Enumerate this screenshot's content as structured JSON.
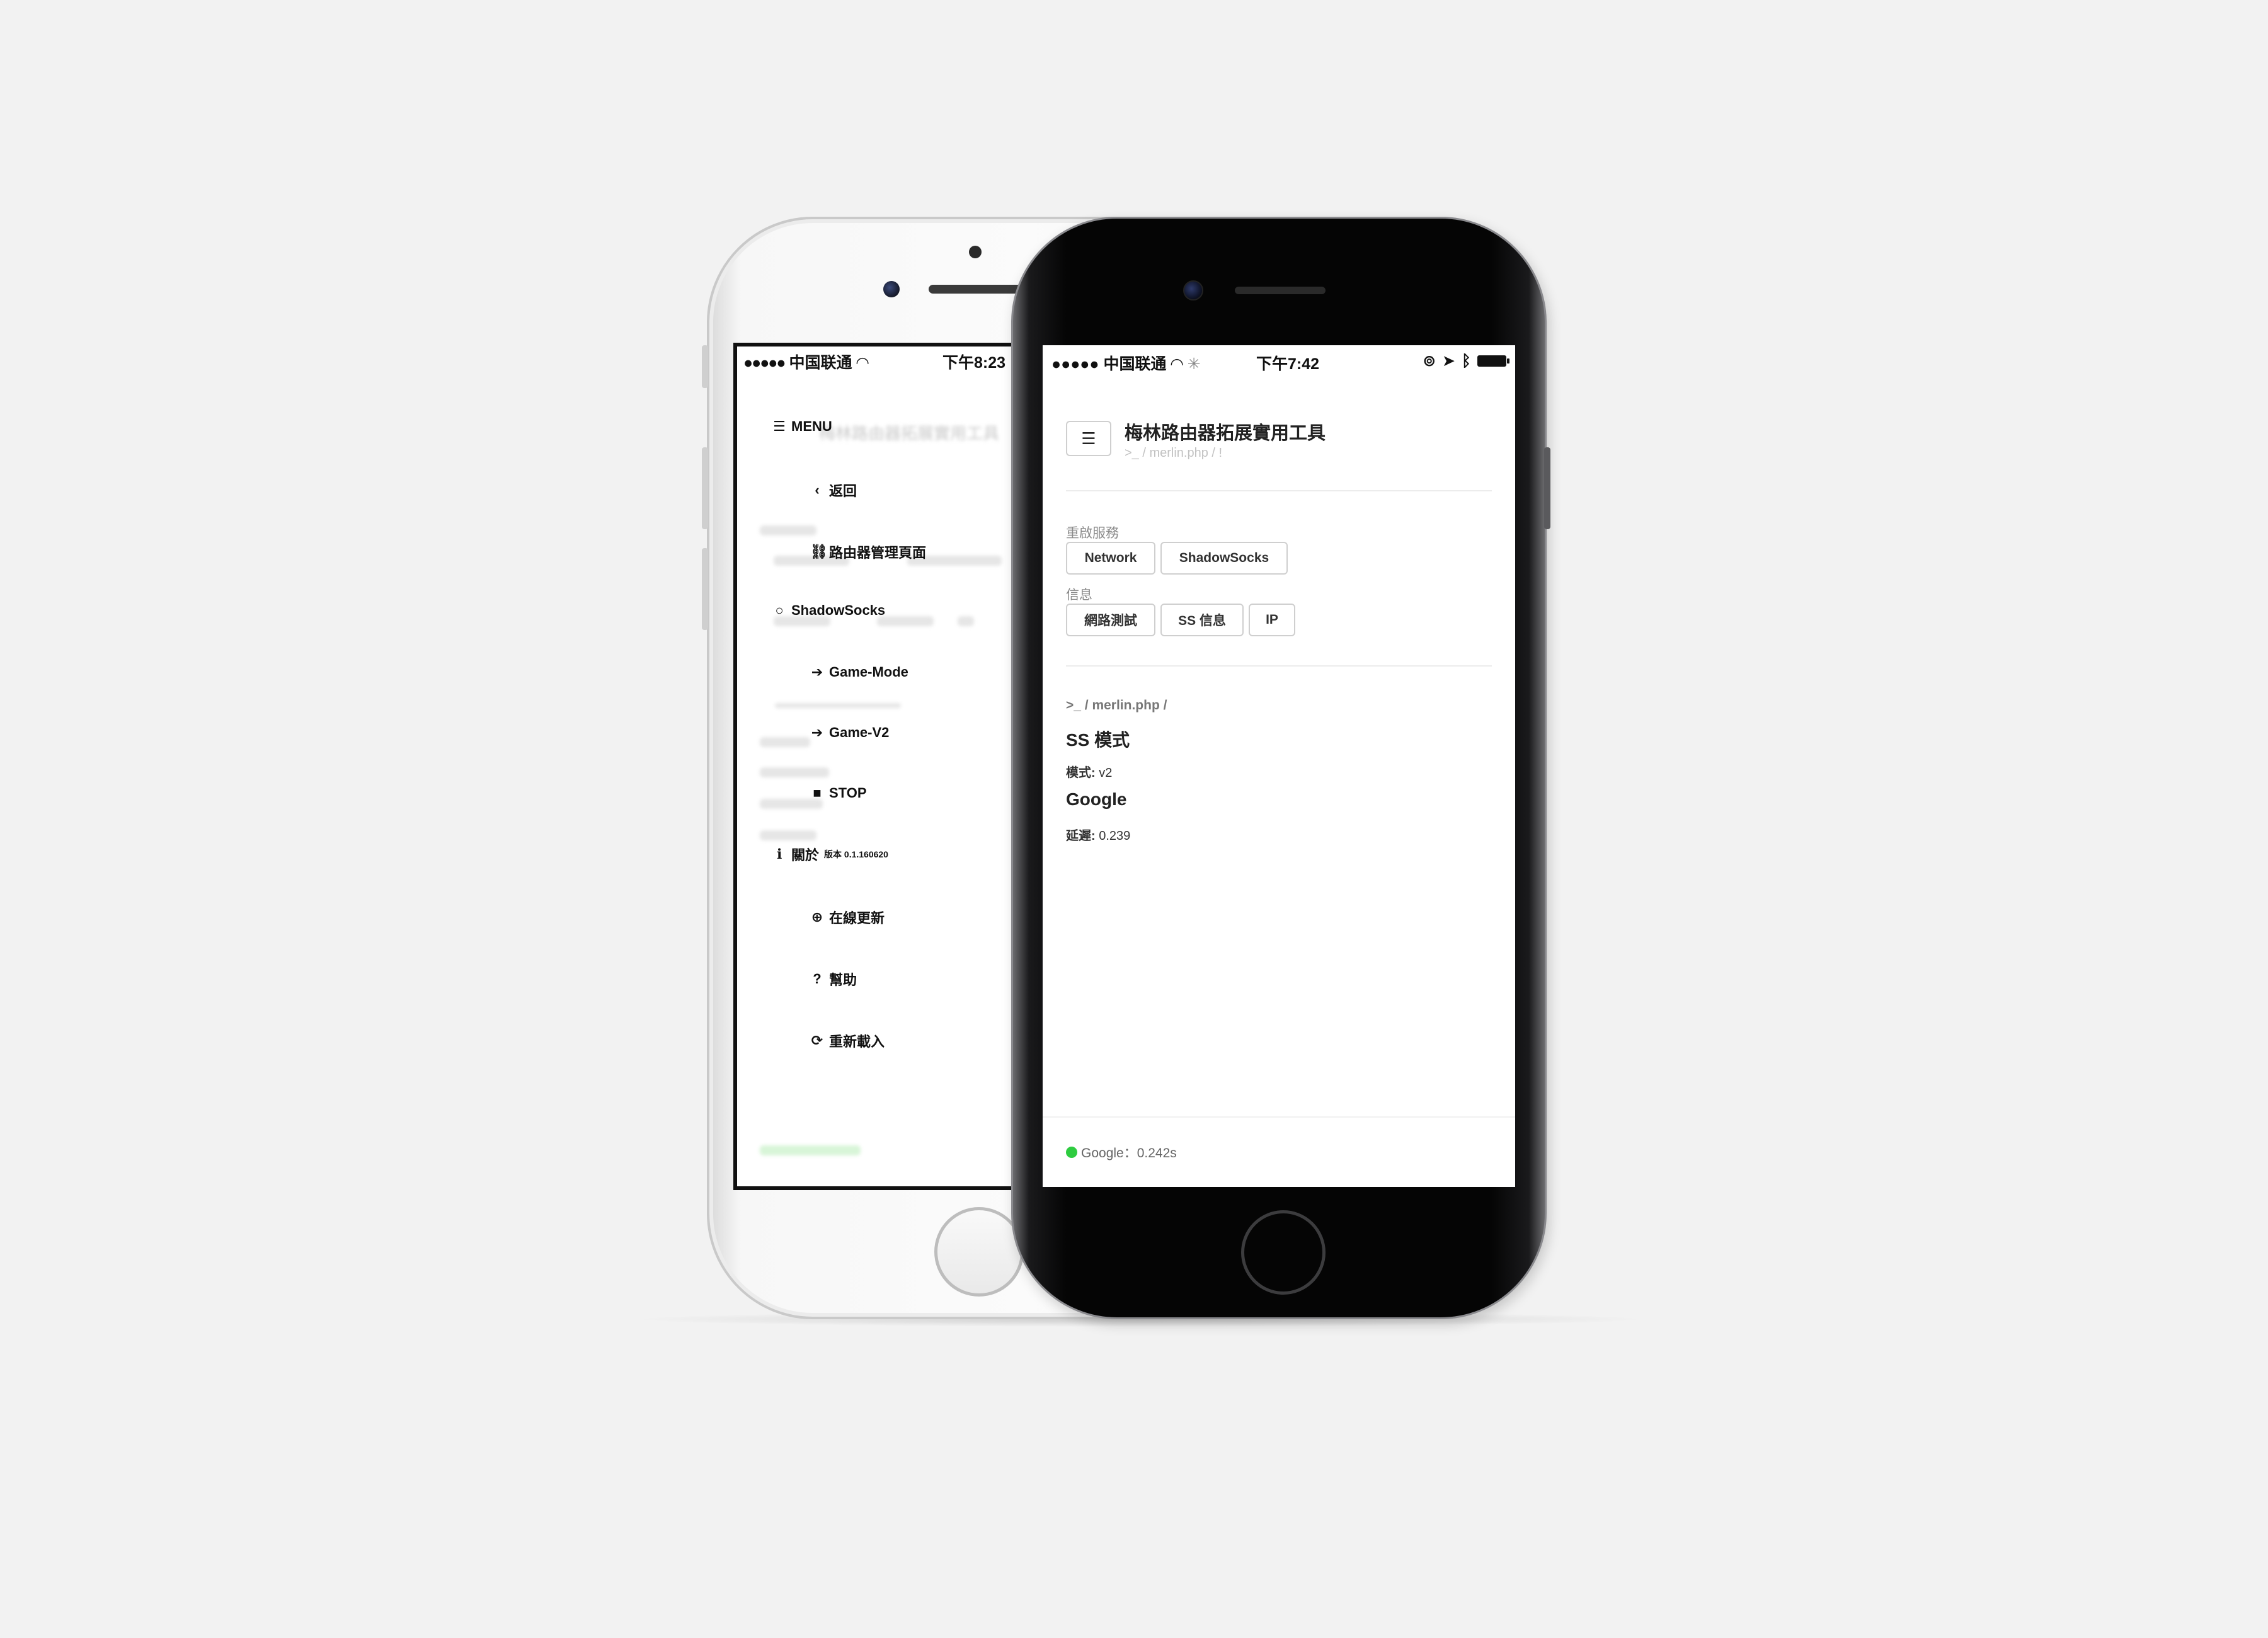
{
  "left_phone": {
    "status": {
      "signal": "●●●●●",
      "carrier": "中国联通",
      "time": "下午8:23"
    },
    "menu": {
      "header": "MENU",
      "items": [
        {
          "icon": "chevron-left-icon",
          "glyph": "‹",
          "label": "返回"
        },
        {
          "icon": "link-icon",
          "glyph": "⛓",
          "label": "路由器管理頁面"
        },
        {
          "icon": "circle-icon",
          "glyph": "○",
          "label": "ShadowSocks"
        },
        {
          "icon": "arrow-right-icon",
          "glyph": "➔",
          "label": "Game-Mode"
        },
        {
          "icon": "arrow-right-icon",
          "glyph": "➔",
          "label": "Game-V2"
        },
        {
          "icon": "stop-icon",
          "glyph": "■",
          "label": "STOP"
        },
        {
          "icon": "info-icon",
          "glyph": "ℹ",
          "label": "關於",
          "extra": "版本 0.1.160620"
        },
        {
          "icon": "arrow-circle-up-icon",
          "glyph": "⊕",
          "label": "在線更新"
        },
        {
          "icon": "question-icon",
          "glyph": "?",
          "label": "幫助"
        },
        {
          "icon": "refresh-icon",
          "glyph": "⟳",
          "label": "重新載入"
        }
      ]
    }
  },
  "right_phone": {
    "status": {
      "signal": "●●●●●",
      "carrier": "中国联通",
      "time": "下午7:42"
    },
    "header": {
      "menu_icon": "☰",
      "title": "梅林路由器拓展實用工具",
      "path": ">_ / merlin.php / !"
    },
    "restart": {
      "label": "重啟服務",
      "buttons": [
        "Network",
        "ShadowSocks"
      ]
    },
    "info": {
      "label": "信息",
      "buttons": [
        "網路測試",
        "SS 信息",
        "IP"
      ]
    },
    "result": {
      "breadcrumb": ">_ / merlin.php /",
      "ss_heading": "SS 模式",
      "mode_key": "模式:",
      "mode_value": "v2",
      "google_heading": "Google",
      "latency_key": "延遲:",
      "latency_value": "0.239"
    },
    "footer": {
      "text": "Google：0.242s",
      "status_color": "#2ecc40"
    }
  }
}
